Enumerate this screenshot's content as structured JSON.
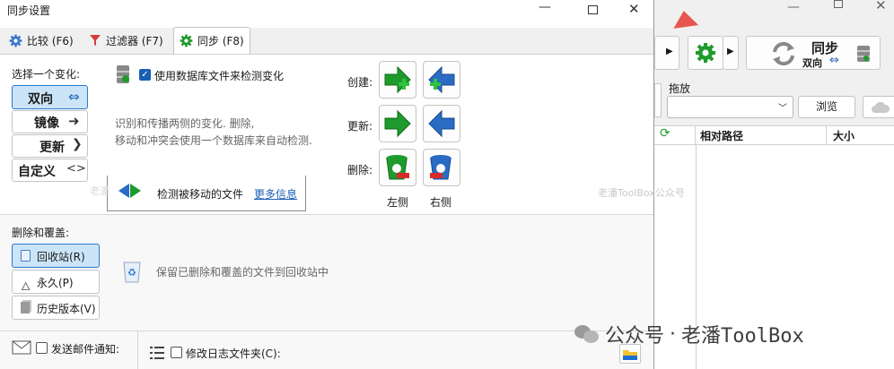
{
  "dialog": {
    "title": "同步设置",
    "tabs": [
      {
        "label": "比较 (F6)"
      },
      {
        "label": "过滤器 (F7)"
      },
      {
        "label": "同步 (F8)"
      }
    ],
    "variant_heading": "选择一个变化:",
    "variants": [
      {
        "label": "双向",
        "icon": "arrow-bidirectional-icon"
      },
      {
        "label": "镜像",
        "icon": "arrow-right-icon"
      },
      {
        "label": "更新",
        "icon": "chevron-right-icon"
      },
      {
        "label": "自定义",
        "icon": "angle-brackets-icon"
      }
    ],
    "use_db_label": "使用数据库文件来检测变化",
    "use_db_checked": true,
    "description_line1": "识别和传播两侧的变化. 删除,",
    "description_line2": "移动和冲突会使用一个数据库来自动检测.",
    "detect_moved_label": "检测被移动的文件",
    "more_info_label": "更多信息",
    "actions": {
      "create": "创建:",
      "update": "更新:",
      "delete": "删除:"
    },
    "side_left": "左侧",
    "side_right": "右侧",
    "delete_heading": "删除和覆盖:",
    "delete_options": [
      {
        "label": "回收站(R)",
        "selected": true
      },
      {
        "label": "永久(P)"
      },
      {
        "label": "历史版本(V)"
      }
    ],
    "delete_description": "保留已删除和覆盖的文件到回收站中",
    "email_label": "发送邮件通知:",
    "log_folder_label": "修改日志文件夹(C):",
    "watermark_small": "老潘ToolBox公众号"
  },
  "background_window": {
    "sync_label": "同步",
    "sync_sub": "双向",
    "drop_label": "拖放",
    "browse_label": "浏览",
    "col_relative_path": "相对路径",
    "col_size": "大小"
  },
  "watermark": {
    "dot": "·",
    "account": "公众号",
    "name": "老潘ToolBox"
  },
  "colors": {
    "accent": "#1b5fb4",
    "selected_bg": "#cce4f7",
    "green": "#1e9b2c",
    "blue": "#2a6bc4"
  }
}
